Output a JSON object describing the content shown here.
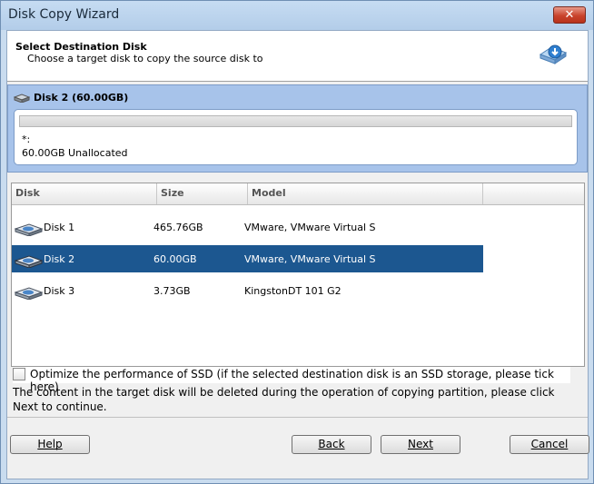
{
  "window": {
    "title": "Disk Copy Wizard",
    "close_glyph": "✕"
  },
  "header": {
    "title": "Select Destination Disk",
    "subtitle": "Choose a target disk to copy the source disk to",
    "icon": "disk-download-icon"
  },
  "selected_disk": {
    "title": "Disk 2 (60.00GB)",
    "partition_label": "*:",
    "partition_info": "60.00GB Unallocated"
  },
  "table": {
    "columns": [
      "Disk",
      "Size",
      "Model"
    ],
    "rows": [
      {
        "disk": "Disk 1",
        "size": "465.76GB",
        "model": "VMware, VMware Virtual S",
        "selected": false
      },
      {
        "disk": "Disk 2",
        "size": "60.00GB",
        "model": "VMware, VMware Virtual S",
        "selected": true
      },
      {
        "disk": "Disk 3",
        "size": "3.73GB",
        "model": "KingstonDT 101 G2",
        "selected": false
      }
    ]
  },
  "options": {
    "ssd_label": "Optimize the performance of SSD (if the selected destination disk is an SSD storage, please tick here)",
    "ssd_checked": false,
    "note": "The content in the target disk will be deleted during the operation of copying partition, please click Next to continue."
  },
  "buttons": {
    "help": "Help",
    "back": "Back",
    "next": "Next",
    "cancel": "Cancel"
  },
  "colors": {
    "selection": "#1c5790",
    "panel": "#a7c3ea"
  }
}
